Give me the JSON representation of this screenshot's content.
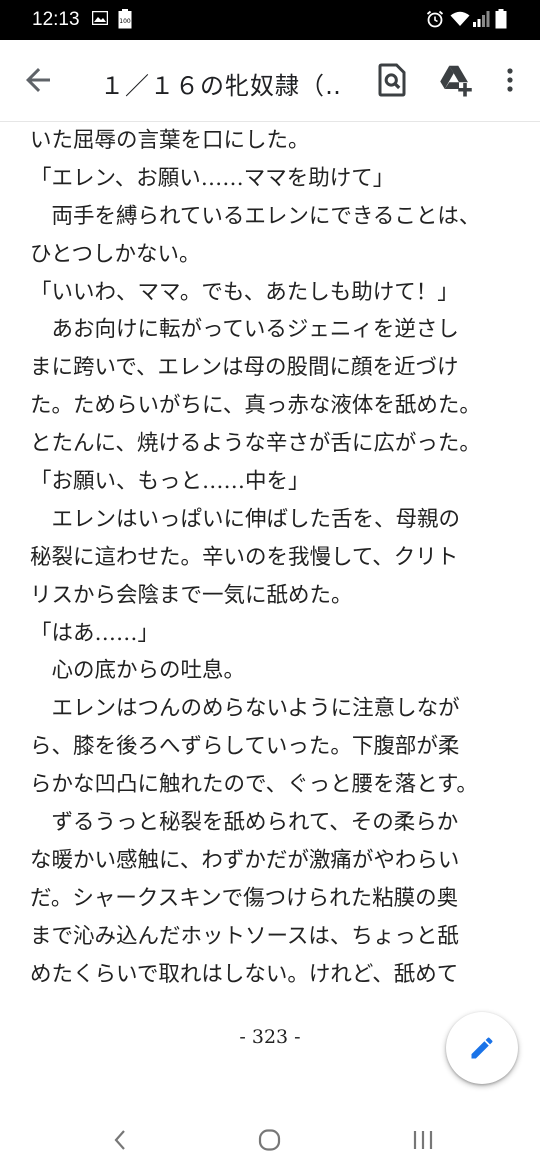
{
  "status_bar": {
    "time": "12:13",
    "battery_level": "100"
  },
  "app_bar": {
    "title": "１／１６の牝奴隷（…"
  },
  "document": {
    "lines": [
      "いた屈辱の言葉を口にした。",
      "「エレン、お願い……ママを助けて」",
      "　両手を縛られているエレンにできることは、",
      "ひとつしかない。",
      "「いいわ、ママ。でも、あたしも助けて！」",
      "　あお向けに転がっているジェニィを逆さし",
      "まに跨いで、エレンは母の股間に顔を近づけ",
      "た。ためらいがちに、真っ赤な液体を舐めた。",
      "とたんに、焼けるような辛さが舌に広がった。",
      "「お願い、もっと……中を」",
      "　エレンはいっぱいに伸ばした舌を、母親の",
      "秘裂に這わせた。辛いのを我慢して、クリト",
      "リスから会陰まで一気に舐めた。",
      "「はあ……」",
      "　心の底からの吐息。",
      "　エレンはつんのめらないように注意しなが",
      "ら、膝を後ろへずらしていった。下腹部が柔",
      "らかな凹凸に触れたので、ぐっと腰を落とす。",
      "　ずるうっと秘裂を舐められて、その柔らか",
      "な暖かい感触に、わずかだが激痛がやわらい",
      "だ。シャークスキンで傷つけられた粘膜の奥",
      "まで沁み込んだホットソースは、ちょっと舐",
      "めたくらいで取れはしない。けれど、舐めて"
    ],
    "page_number": "- 323 -"
  },
  "colors": {
    "accent": "#1a73e8",
    "text": "#222222",
    "status_bg": "#000000"
  },
  "icons": [
    "back-arrow-icon",
    "find-in-page-icon",
    "add-to-drive-icon",
    "more-vert-icon",
    "edit-pencil-icon",
    "nav-back-icon",
    "nav-home-icon",
    "nav-recents-icon"
  ]
}
